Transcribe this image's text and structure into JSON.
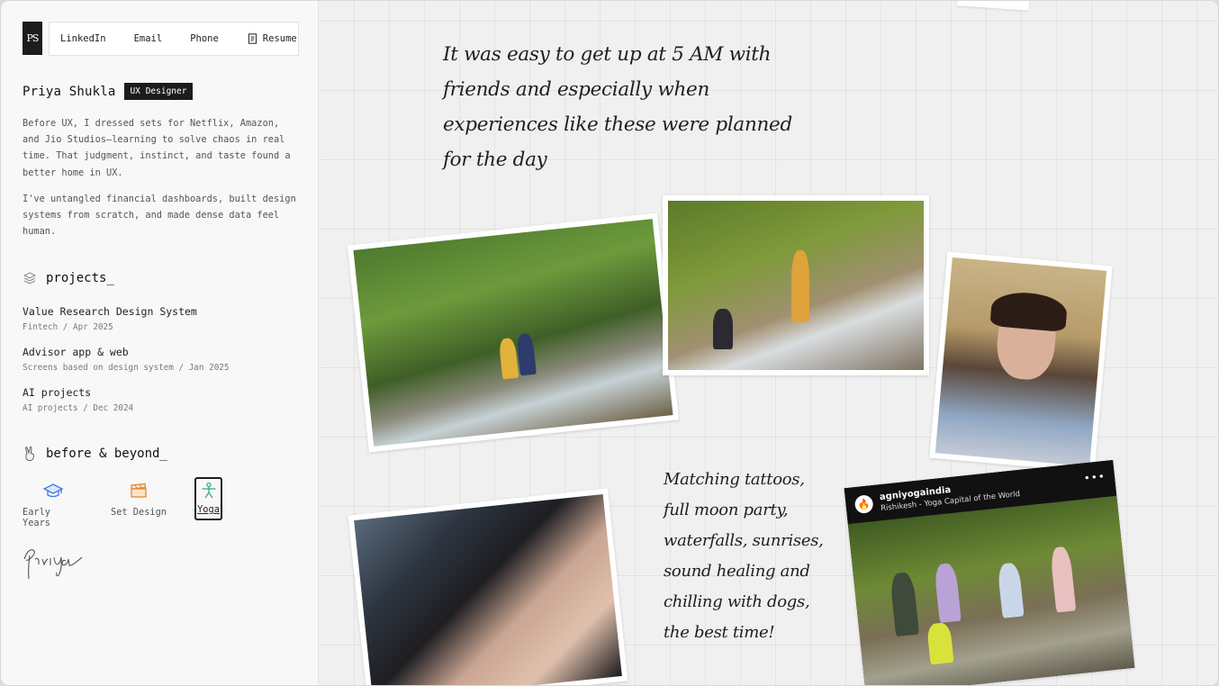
{
  "nav": {
    "logo_text": "PS",
    "linkedin": "LinkedIn",
    "email": "Email",
    "phone": "Phone",
    "resume": "Resume"
  },
  "profile": {
    "name": "Priya Shukla",
    "badge": "UX Designer",
    "bio_1": "Before UX, I dressed sets for Netflix, Amazon, and Jio Studios—learning to solve chaos in real time. That judgment, instinct, and taste found a better home in UX.",
    "bio_2": "I've untangled financial dashboards, built design systems from scratch, and made dense data feel human."
  },
  "projects": {
    "heading": "projects_",
    "items": [
      {
        "title": "Value Research Design System",
        "sub": "Fintech / Apr 2025"
      },
      {
        "title": "Advisor app & web",
        "sub": "Screens based on design system / Jan 2025"
      },
      {
        "title": "AI projects",
        "sub": "AI projects / Dec 2024"
      }
    ]
  },
  "beyond": {
    "heading": "before & beyond_",
    "items": [
      {
        "label": "Early Years",
        "icon": "graduation-cap-icon"
      },
      {
        "label": "Set Design",
        "icon": "clapperboard-icon"
      },
      {
        "label": "Yoga",
        "icon": "yoga-pose-icon"
      }
    ],
    "selected": "Yoga"
  },
  "main": {
    "quote_1": "It was easy to get up at 5 AM with friends and especially when experiences like these were planned for the day",
    "quote_2_lines": [
      "Matching tattoos,",
      "full moon party,",
      "waterfalls, sunrises,",
      "sound healing  and",
      "chilling with dogs,",
      "the best time!"
    ],
    "post": {
      "account": "agniyogaindia",
      "location": "Rishikesh - Yoga Capital of the World",
      "menu": "•••"
    }
  },
  "colors": {
    "accent_dark": "#1c1c1c",
    "cap_blue": "#3b7be0",
    "clapper_orange": "#e08a3a",
    "yoga_teal": "#2fae8f"
  }
}
